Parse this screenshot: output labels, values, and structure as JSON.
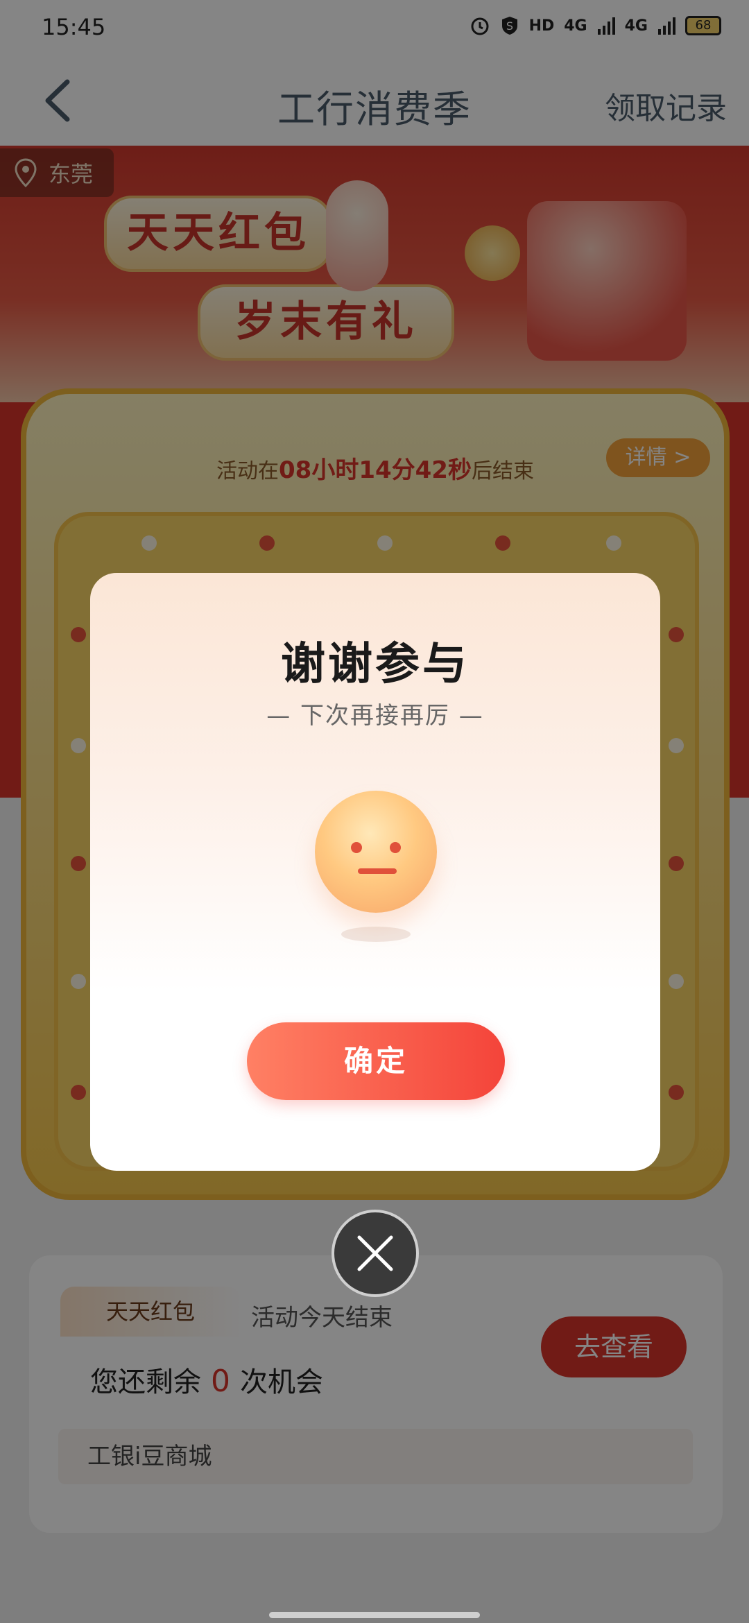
{
  "status_bar": {
    "time": "15:45",
    "icons": [
      "alarm-icon",
      "shield-s-icon",
      "hd-icon",
      "signal-4g-icon",
      "signal-4g-icon-2"
    ],
    "hd_label": "HD",
    "net1": "4G",
    "net2": "4G",
    "battery": "68"
  },
  "nav": {
    "title": "工行消费季",
    "right_action": "领取记录"
  },
  "banner": {
    "location": "东莞",
    "headline_1": "天天红包",
    "headline_2": "岁末有礼"
  },
  "game": {
    "timer_prefix": "活动在",
    "countdown": "08小时14分42秒",
    "timer_suffix": "后结束",
    "detail_label": "详情 >"
  },
  "info_card": {
    "tab_label": "天天红包",
    "tab_note": "活动今天结束",
    "chance_prefix": "您还剩余",
    "chance_count": "0",
    "chance_suffix": "次机会",
    "go_button": "去查看",
    "mall_label": "工银i豆商城"
  },
  "modal": {
    "title": "谢谢参与",
    "subtitle": "— 下次再接再厉 —",
    "confirm_label": "确定"
  },
  "colors": {
    "accent_red": "#d9342b",
    "button_gradient_start": "#ff8064",
    "button_gradient_end": "#f4443a",
    "nav_text": "#4a5a6a"
  }
}
